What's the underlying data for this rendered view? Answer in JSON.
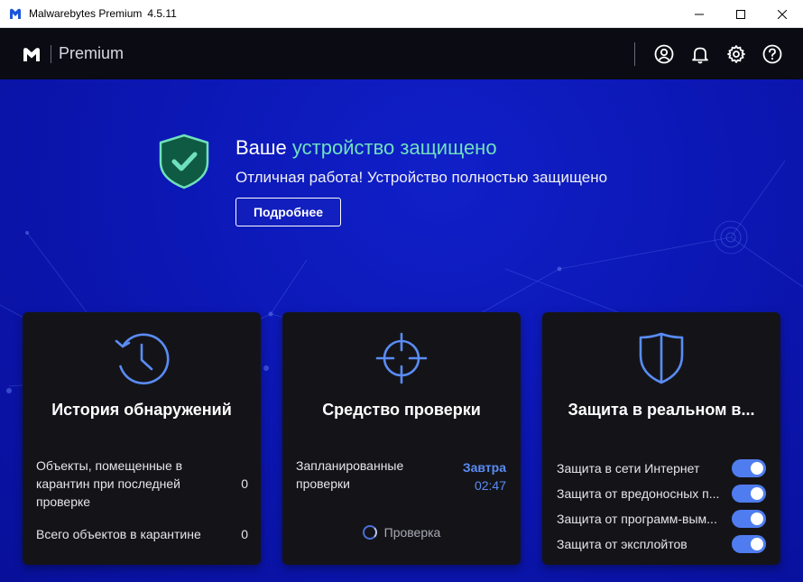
{
  "window": {
    "app_name": "Malwarebytes Premium",
    "version": "4.5.11"
  },
  "header": {
    "product": "Premium"
  },
  "hero": {
    "title_prefix": "Ваше",
    "title_accent": "устройство защищено",
    "subtitle": "Отличная работа! Устройство полностью защищено",
    "details_button": "Подробнее"
  },
  "cards": {
    "history": {
      "title": "История обнаружений",
      "quarantined_last_label": "Объекты, помещенные в карантин при последней проверке",
      "quarantined_last_value": "0",
      "quarantine_total_label": "Всего объектов в карантине",
      "quarantine_total_value": "0"
    },
    "scanner": {
      "title": "Средство проверки",
      "scheduled_label": "Запланированные проверки",
      "scheduled_day": "Завтра",
      "scheduled_time": "02:47",
      "scan_label": "Проверка"
    },
    "realtime": {
      "title": "Защита в реальном в...",
      "items": [
        {
          "label": "Защита в сети Интернет",
          "enabled": true
        },
        {
          "label": "Защита от вредоносных п...",
          "enabled": true
        },
        {
          "label": "Защита от программ-вым...",
          "enabled": true
        },
        {
          "label": "Защита от эксплойтов",
          "enabled": true
        }
      ]
    }
  },
  "colors": {
    "accent_green": "#70e0c0",
    "accent_blue": "#5a8cf5",
    "toggle_on": "#4f7df0",
    "background_blue": "#0c17b4",
    "card_bg": "#141418"
  },
  "icons": {
    "app": "malwarebytes-logo-icon",
    "account": "account-icon",
    "notifications": "bell-icon",
    "settings": "gear-icon",
    "help": "help-icon",
    "history": "clock-history-icon",
    "scanner": "crosshair-icon",
    "realtime": "shield-icon"
  }
}
